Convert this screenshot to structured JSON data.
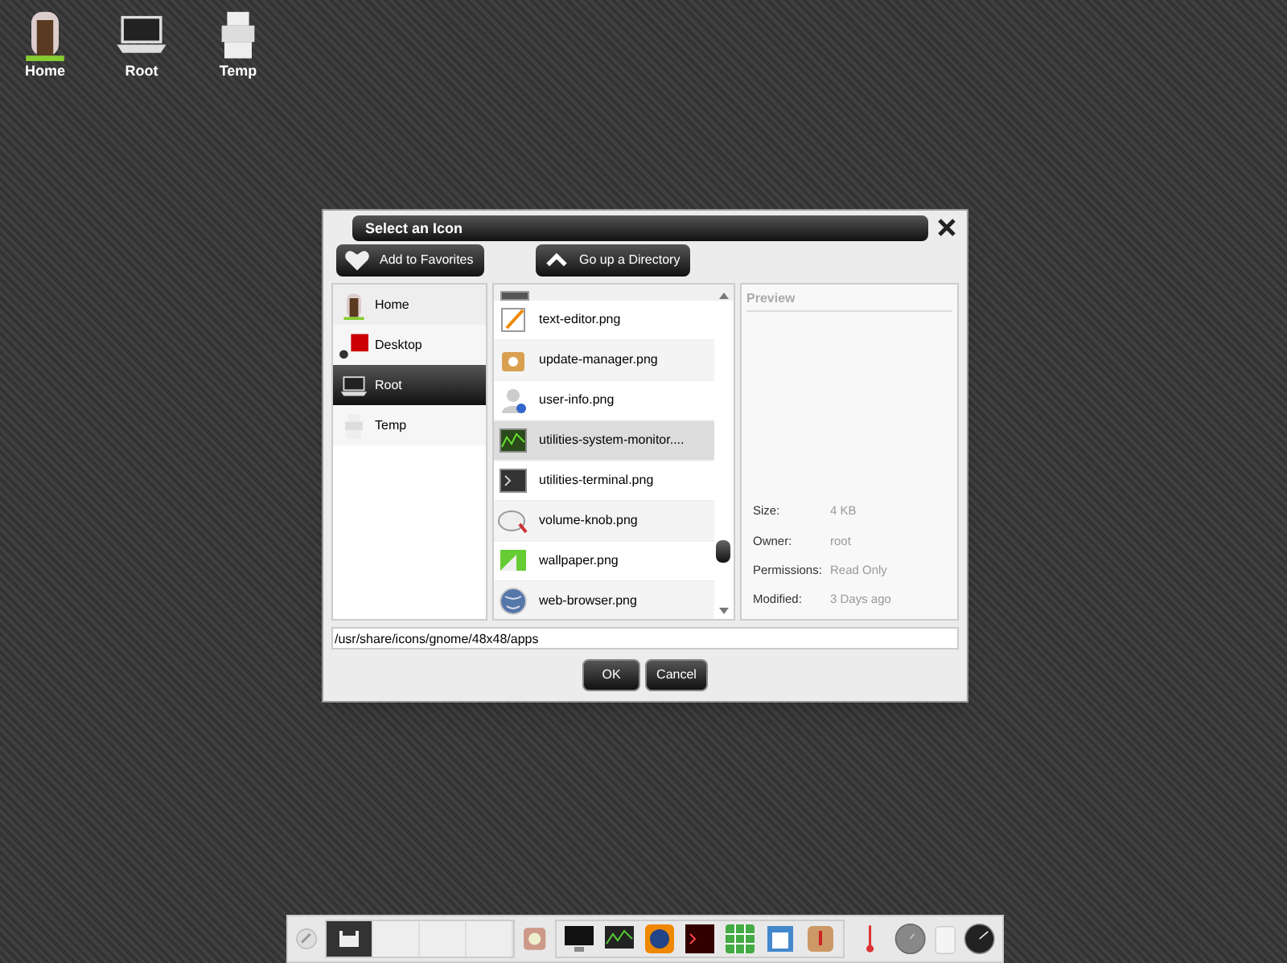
{
  "desktop_icons": [
    {
      "label": "Home",
      "kind": "door"
    },
    {
      "label": "Root",
      "kind": "laptop"
    },
    {
      "label": "Temp",
      "kind": "boxes"
    }
  ],
  "dialog": {
    "title": "Select an Icon",
    "toolbar": [
      {
        "label": "Add to Favorites",
        "kind": "heart"
      },
      {
        "label": "Go up a Directory",
        "kind": "up"
      }
    ],
    "places": [
      {
        "label": "Home",
        "kind": "door",
        "selected": false
      },
      {
        "label": "Desktop",
        "kind": "desktop",
        "selected": false
      },
      {
        "label": "Root",
        "kind": "laptop",
        "selected": true
      },
      {
        "label": "Temp",
        "kind": "boxes",
        "selected": false
      }
    ],
    "files": [
      {
        "name": "text-editor.png",
        "kind": "editor",
        "selected": false
      },
      {
        "name": "update-manager.png",
        "kind": "package",
        "selected": false
      },
      {
        "name": "user-info.png",
        "kind": "user",
        "selected": false
      },
      {
        "name": "utilities-system-monitor....",
        "kind": "monitor",
        "selected": true
      },
      {
        "name": "utilities-terminal.png",
        "kind": "terminal",
        "selected": false
      },
      {
        "name": "volume-knob.png",
        "kind": "knob",
        "selected": false
      },
      {
        "name": "wallpaper.png",
        "kind": "wallpaper",
        "selected": false
      },
      {
        "name": "web-browser.png",
        "kind": "globe",
        "selected": false
      }
    ],
    "preview": {
      "title": "Preview",
      "properties": [
        {
          "label": "Size:",
          "value": "4 KB"
        },
        {
          "label": "Owner:",
          "value": "root"
        },
        {
          "label": "Permissions:",
          "value": "Read Only"
        },
        {
          "label": "Modified:",
          "value": "3 Days ago"
        }
      ]
    },
    "path": "/usr/share/icons/gnome/48x48/apps",
    "buttons": [
      "OK",
      "Cancel"
    ]
  },
  "taskbar": {
    "workspaces": [
      {
        "selected": true
      },
      {
        "selected": false
      },
      {
        "selected": false
      },
      {
        "selected": false
      }
    ]
  }
}
